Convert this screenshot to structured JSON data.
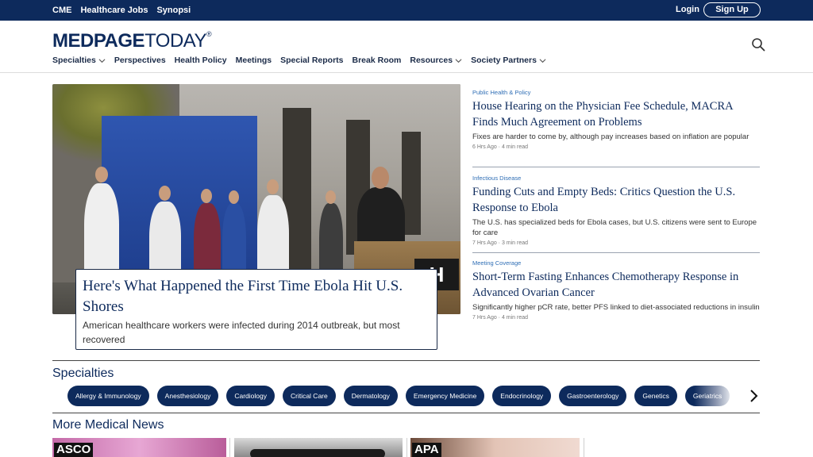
{
  "topbar": {
    "links": [
      "CME",
      "Healthcare Jobs",
      "Synopsi"
    ],
    "login": "Login",
    "signup": "Sign Up"
  },
  "header": {
    "logo_bold": "MEDPAGE",
    "logo_light": "TODAY",
    "logo_mark": "®",
    "search_icon": "search-icon"
  },
  "nav": [
    {
      "label": "Specialties",
      "dropdown": true
    },
    {
      "label": "Perspectives",
      "dropdown": false
    },
    {
      "label": "Health Policy",
      "dropdown": false
    },
    {
      "label": "Meetings",
      "dropdown": false
    },
    {
      "label": "Special Reports",
      "dropdown": false
    },
    {
      "label": "Break Room",
      "dropdown": false
    },
    {
      "label": "Resources",
      "dropdown": true
    },
    {
      "label": "Society Partners",
      "dropdown": true
    }
  ],
  "hero": {
    "title": "Here's What Happened the First Time Ebola Hit U.S. Shores",
    "dek": "American healthcare workers were infected during 2014 outbreak, but most recovered",
    "image_sign_letter": "H"
  },
  "stories": [
    {
      "category": "Public Health & Policy",
      "headline": "House Hearing on the Physician Fee Schedule, MACRA Finds Much Agreement on Problems",
      "dek": "Fixes are harder to come by, although pay increases based on inflation are popular",
      "meta": "6 Hrs Ago · 4 min read"
    },
    {
      "category": "Infectious Disease",
      "headline": "Funding Cuts and Empty Beds: Critics Question the U.S. Response to Ebola",
      "dek": "The U.S. has specialized beds for Ebola cases, but U.S. citizens were sent to Europe for care",
      "meta": "7 Hrs Ago · 3 min read"
    },
    {
      "category": "Meeting Coverage",
      "headline": "Short-Term Fasting Enhances Chemotherapy Response in Advanced Ovarian Cancer",
      "dek": "Significantly higher pCR rate, better PFS linked to diet-associated reductions in insulin",
      "meta": "7 Hrs Ago · 4 min read"
    }
  ],
  "specialties": {
    "title": "Specialties",
    "items": [
      "Allergy & Immunology",
      "Anesthesiology",
      "Cardiology",
      "Critical Care",
      "Dermatology",
      "Emergency Medicine",
      "Endocrinology",
      "Gastroenterology",
      "Genetics",
      "Geriatrics"
    ]
  },
  "more_news": {
    "title": "More Medical News",
    "thumbs": [
      {
        "tag": "ASCO"
      },
      {
        "tag": ""
      },
      {
        "tag": "APA"
      }
    ]
  },
  "colors": {
    "brand_navy": "#0d2a5c",
    "link_blue": "#2f6eb5"
  }
}
